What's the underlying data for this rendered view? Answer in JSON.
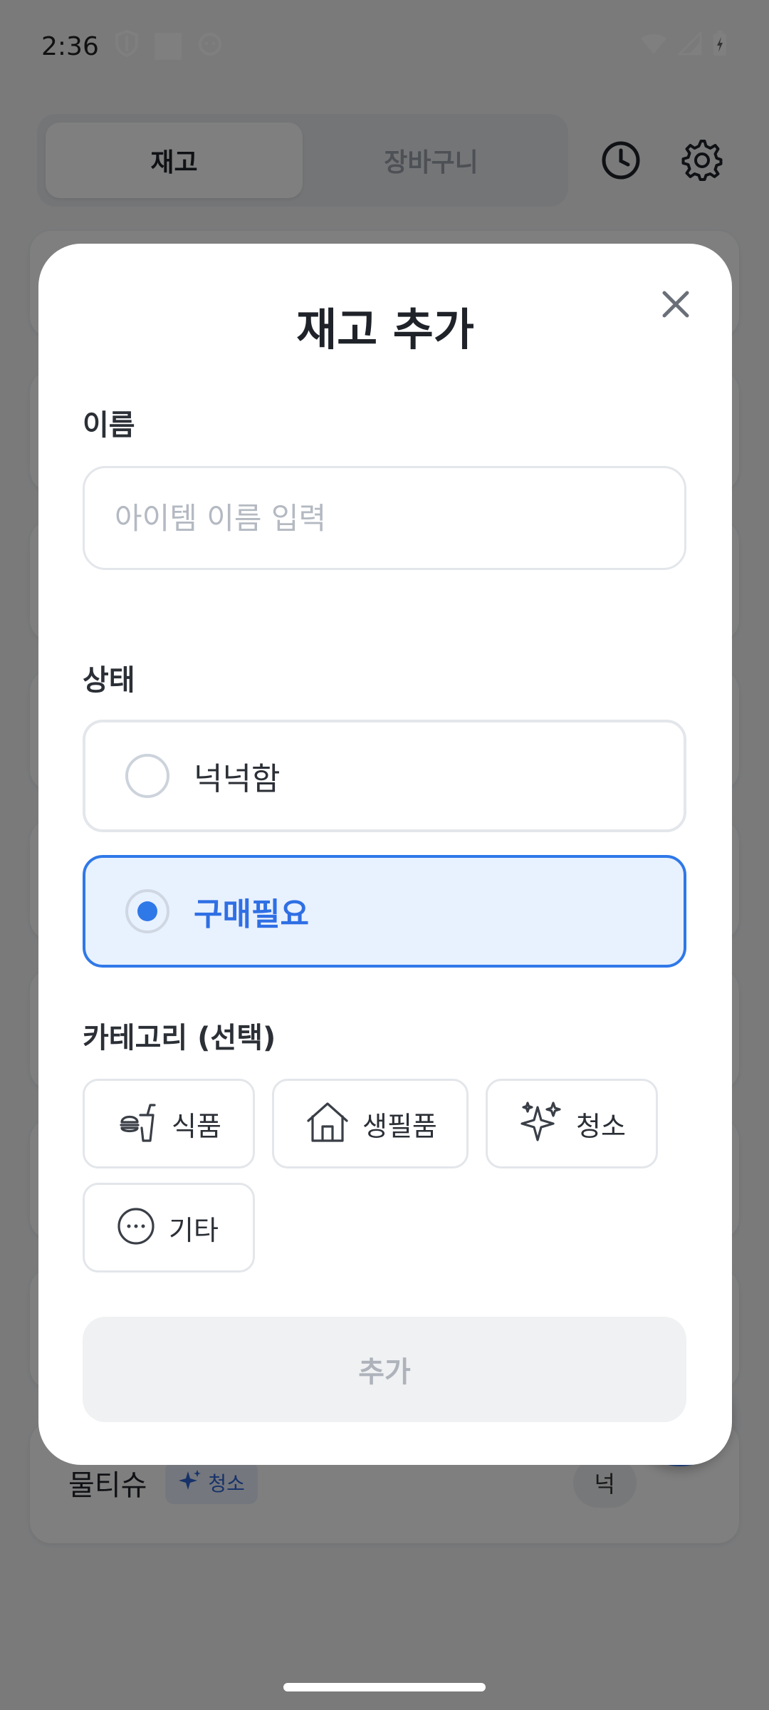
{
  "status_bar": {
    "time": "2:36"
  },
  "top_tabs": [
    {
      "label": "재고",
      "active": true
    },
    {
      "label": "장바구니",
      "active": false
    }
  ],
  "background_list": {
    "item_name": "물티슈",
    "item_category_chip": "청소",
    "item_status_fragment": "넉"
  },
  "dialog": {
    "title": "재고 추가",
    "name_label": "이름",
    "name_placeholder": "아이템 이름 입력",
    "name_value": "",
    "status_label": "상태",
    "status_options": [
      {
        "label": "넉넉함",
        "selected": false
      },
      {
        "label": "구매필요",
        "selected": true
      }
    ],
    "category_label": "카테고리 (선택)",
    "categories": [
      {
        "label": "식품",
        "icon": "food-icon"
      },
      {
        "label": "생필품",
        "icon": "house-icon"
      },
      {
        "label": "청소",
        "icon": "sparkle-icon"
      },
      {
        "label": "기타",
        "icon": "more-icon"
      }
    ],
    "submit_label": "추가"
  },
  "colors": {
    "accent": "#2f78e8",
    "selected_bg": "#e8f1fe",
    "border": "#e3e6ea",
    "disabled_text": "#aeb3bb"
  }
}
